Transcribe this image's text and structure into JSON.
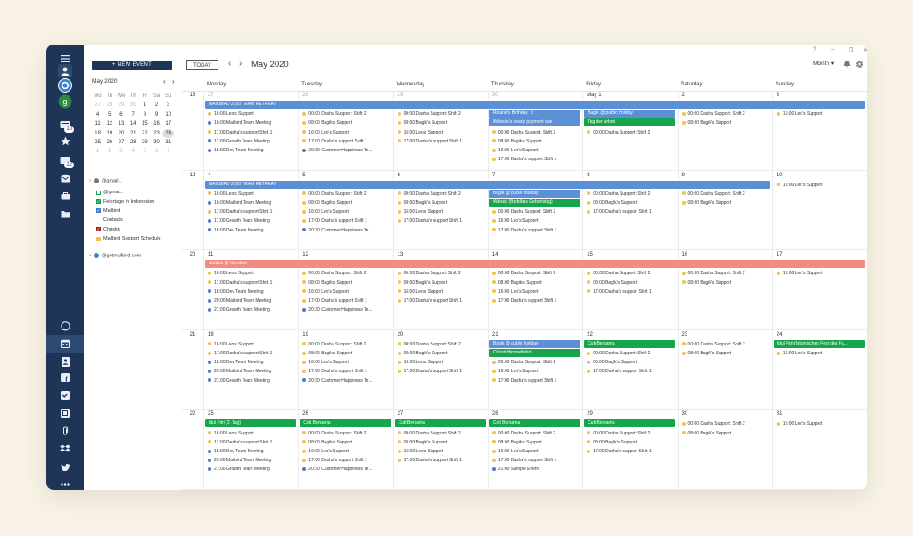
{
  "window": {
    "controls": [
      "?",
      "–",
      "❐",
      "✕"
    ]
  },
  "colors": {
    "blue": "#5b8fd6",
    "green": "#16a54a",
    "salmon": "#f08d82",
    "rail": "#1e3557",
    "dot_yellow": "#f3c14c",
    "dot_blue": "#4a7cc8"
  },
  "sidebar": {
    "new_event": "+ NEW EVENT",
    "mini_title": "May 2020",
    "weekday_heads": [
      "Mo",
      "Tu",
      "We",
      "Th",
      "Fr",
      "Sa",
      "Su"
    ],
    "mini_weeks": [
      [
        "27",
        "28",
        "29",
        "30",
        "1",
        "2",
        "3"
      ],
      [
        "4",
        "5",
        "6",
        "7",
        "8",
        "9",
        "10"
      ],
      [
        "11",
        "12",
        "13",
        "14",
        "15",
        "16",
        "17"
      ],
      [
        "18",
        "19",
        "20",
        "21",
        "22",
        "23",
        "24"
      ],
      [
        "25",
        "26",
        "27",
        "28",
        "29",
        "30",
        "31"
      ],
      [
        "1",
        "2",
        "3",
        "4",
        "5",
        "6",
        "7"
      ]
    ],
    "account1": "@gmail...",
    "calendars": [
      {
        "label": "@gmai...",
        "checked": false,
        "color": ""
      },
      {
        "label": "Feiertage in Indonesien",
        "checked": true,
        "color": "#16a54a"
      },
      {
        "label": "Mailbird",
        "checked": true,
        "color": "#4a7cc8"
      },
      {
        "label": "Contacts",
        "checked": false,
        "color": "none"
      },
      {
        "label": "Christin",
        "checked": true,
        "color": "#b01c2e"
      },
      {
        "label": "Mailbird Support Schedule",
        "checked": false,
        "color": "#f3c14c"
      }
    ],
    "account2": "@getmailbird.com"
  },
  "toolbar": {
    "today": "TODAY",
    "month_title": "May 2020",
    "view": "Month"
  },
  "day_headers": [
    "Monday",
    "Tuesday",
    "Wednesday",
    "Thursday",
    "Friday",
    "Saturday",
    "Sunday"
  ],
  "weeks": [
    {
      "num": "18",
      "days": [
        {
          "n": "27",
          "dim": true,
          "events": [
            [
              "y",
              "16:00 Leo's Support"
            ],
            [
              "b",
              "16:00 Mailbird Team Meeting"
            ],
            [
              "y",
              "17:00 Dasha's support Shift 1"
            ],
            [
              "b",
              "17:00 Growth Team Meeting"
            ],
            [
              "b",
              "18:00 Dev Team Meeting"
            ]
          ]
        },
        {
          "n": "28",
          "dim": true,
          "events": [
            [
              "y",
              "00:00 Dasha Support: Shift 2"
            ],
            [
              "y",
              "08:00 Bagik's Support"
            ],
            [
              "y",
              "16:00 Leo's Support"
            ],
            [
              "y",
              "17:00 Dasha's support Shift 1"
            ],
            [
              "b",
              "20:30 Customer Happiness Te..."
            ]
          ]
        },
        {
          "n": "29",
          "dim": true,
          "events": [
            [
              "y",
              "00:00 Dasha Support: Shift 2"
            ],
            [
              "y",
              "08:00 Bagik's Support"
            ],
            [
              "y",
              "16:00 Leo's Support"
            ],
            [
              "y",
              "17:00 Dasha's support Shift 1"
            ]
          ]
        },
        {
          "n": "30",
          "dim": true,
          "events": [
            [
              "y",
              "00:00 Dasha Support: Shift 2"
            ],
            [
              "y",
              "08:00 Bagik's Support"
            ],
            [
              "y",
              "16:00 Leo's Support"
            ],
            [
              "y",
              "17:00 Dasha's support Shift 1"
            ]
          ]
        },
        {
          "n": "May 1",
          "dim": false,
          "events": [
            [
              "y",
              "00:00 Dasha Support: Shift 2"
            ]
          ]
        },
        {
          "n": "2",
          "dim": false,
          "events": [
            [
              "y",
              "00:00 Dasha Support: Shift 2"
            ],
            [
              "y",
              "08:00 Bagik's Support"
            ]
          ]
        },
        {
          "n": "3",
          "dim": false,
          "events": [
            [
              "y",
              "16:00 Leo's Support"
            ]
          ]
        }
      ],
      "bars": [
        {
          "label": "MAILBIRD 2020 TEAM RETREAT",
          "start": 0,
          "end": 7,
          "row": 0,
          "color": "blue"
        },
        {
          "label": "Roland's Birthday :D",
          "start": 3,
          "end": 4,
          "row": 1,
          "color": "blue"
        },
        {
          "label": "Website's yearly payment due",
          "start": 3,
          "end": 4,
          "row": 2,
          "color": "blue"
        },
        {
          "label": "Bagik @ public holiday",
          "start": 4,
          "end": 5,
          "row": 1,
          "color": "blue"
        },
        {
          "label": "Tag der Arbeit",
          "start": 4,
          "end": 5,
          "row": 2,
          "color": "green"
        }
      ]
    },
    {
      "num": "19",
      "days": [
        {
          "n": "4",
          "events": [
            [
              "y",
              "16:00 Leo's Support"
            ],
            [
              "b",
              "16:00 Mailbird Team Meeting"
            ],
            [
              "y",
              "17:00 Dasha's support Shift 1"
            ],
            [
              "b",
              "17:00 Growth Team Meeting"
            ],
            [
              "b",
              "18:00 Dev Team Meeting"
            ]
          ]
        },
        {
          "n": "5",
          "events": [
            [
              "y",
              "00:00 Dasha Support: Shift 2"
            ],
            [
              "y",
              "08:00 Bagik's Support"
            ],
            [
              "y",
              "16:00 Leo's Support"
            ],
            [
              "y",
              "17:00 Dasha's support Shift 1"
            ],
            [
              "b",
              "20:30 Customer Happiness Te..."
            ]
          ]
        },
        {
          "n": "6",
          "events": [
            [
              "y",
              "00:00 Dasha Support: Shift 2"
            ],
            [
              "y",
              "08:00 Bagik's Support"
            ],
            [
              "y",
              "16:00 Leo's Support"
            ],
            [
              "y",
              "17:00 Dasha's support Shift 1"
            ]
          ]
        },
        {
          "n": "7",
          "events": [
            [
              "y",
              "00:00 Dasha Support: Shift 2"
            ],
            [
              "y",
              "16:00 Leo's Support"
            ],
            [
              "y",
              "17:00 Dasha's support Shift 1"
            ]
          ]
        },
        {
          "n": "8",
          "events": [
            [
              "y",
              "00:00 Dasha Support: Shift 2"
            ],
            [
              "y",
              "08:00 Bagik's Support"
            ],
            [
              "y",
              "17:00 Dasha's support Shift 1"
            ]
          ]
        },
        {
          "n": "9",
          "events": [
            [
              "y",
              "00:00 Dasha Support: Shift 2"
            ],
            [
              "y",
              "08:00 Bagik's Support"
            ]
          ]
        },
        {
          "n": "10",
          "events": [
            [
              "y",
              "16:00 Leo's Support"
            ]
          ]
        }
      ],
      "bars": [
        {
          "label": "MAILBIRD 2020 TEAM RETREAT",
          "start": 0,
          "end": 6,
          "row": 0,
          "color": "blue"
        },
        {
          "label": "Bagik @ public holiday",
          "start": 3,
          "end": 4,
          "row": 1,
          "color": "blue"
        },
        {
          "label": "Waisak (Buddhas Geburtstag)",
          "start": 3,
          "end": 4,
          "row": 2,
          "color": "green"
        }
      ]
    },
    {
      "num": "20",
      "days": [
        {
          "n": "11",
          "events": [
            [
              "y",
              "16:00 Leo's Support"
            ],
            [
              "y",
              "17:00 Dasha's support Shift 1"
            ],
            [
              "b",
              "18:00 Dev Team Meeting"
            ],
            [
              "b",
              "20:00 Mailbird Team Meeting"
            ],
            [
              "b",
              "21:00 Growth Team Meeting"
            ]
          ]
        },
        {
          "n": "12",
          "events": [
            [
              "y",
              "00:00 Dasha Support: Shift 2"
            ],
            [
              "y",
              "08:00 Bagik's Support"
            ],
            [
              "y",
              "16:00 Leo's Support"
            ],
            [
              "y",
              "17:00 Dasha's support Shift 1"
            ],
            [
              "b",
              "20:30 Customer Happiness Te..."
            ]
          ]
        },
        {
          "n": "13",
          "events": [
            [
              "y",
              "00:00 Dasha Support: Shift 2"
            ],
            [
              "y",
              "08:00 Bagik's Support"
            ],
            [
              "y",
              "16:00 Leo's Support"
            ],
            [
              "y",
              "17:00 Dasha's support Shift 1"
            ]
          ]
        },
        {
          "n": "14",
          "events": [
            [
              "y",
              "00:00 Dasha Support: Shift 2"
            ],
            [
              "y",
              "08:00 Bagik's Support"
            ],
            [
              "y",
              "16:00 Leo's Support"
            ],
            [
              "y",
              "17:00 Dasha's support Shift 1"
            ]
          ]
        },
        {
          "n": "15",
          "events": [
            [
              "y",
              "00:00 Dasha Support: Shift 2"
            ],
            [
              "y",
              "08:00 Bagik's Support"
            ],
            [
              "y",
              "17:00 Dasha's support Shift 1"
            ]
          ]
        },
        {
          "n": "16",
          "events": [
            [
              "y",
              "00:00 Dasha Support: Shift 2"
            ],
            [
              "y",
              "08:00 Bagik's Support"
            ]
          ]
        },
        {
          "n": "17",
          "events": [
            [
              "y",
              "16:00 Leo's Support"
            ]
          ]
        }
      ],
      "bars": [
        {
          "label": "Andrea @ Vacation",
          "start": 0,
          "end": 7,
          "row": 0,
          "color": "salmon"
        }
      ]
    },
    {
      "num": "21",
      "days": [
        {
          "n": "18",
          "events": [
            [
              "y",
              "16:00 Leo's Support"
            ],
            [
              "y",
              "17:00 Dasha's support Shift 1"
            ],
            [
              "b",
              "18:00 Dev Team Meeting"
            ],
            [
              "b",
              "20:00 Mailbird Team Meeting"
            ],
            [
              "b",
              "21:00 Growth Team Meeting"
            ]
          ]
        },
        {
          "n": "19",
          "events": [
            [
              "y",
              "00:00 Dasha Support: Shift 2"
            ],
            [
              "y",
              "08:00 Bagik's Support"
            ],
            [
              "y",
              "16:00 Leo's Support"
            ],
            [
              "y",
              "17:00 Dasha's support Shift 1"
            ],
            [
              "b",
              "20:30 Customer Happiness Te..."
            ]
          ]
        },
        {
          "n": "20",
          "events": [
            [
              "y",
              "00:00 Dasha Support: Shift 2"
            ],
            [
              "y",
              "08:00 Bagik's Support"
            ],
            [
              "y",
              "16:00 Leo's Support"
            ],
            [
              "y",
              "17:00 Dasha's support Shift 1"
            ]
          ]
        },
        {
          "n": "21",
          "events": [
            [
              "y",
              "00:00 Dasha Support: Shift 2"
            ],
            [
              "y",
              "16:00 Leo's Support"
            ],
            [
              "y",
              "17:00 Dasha's support Shift 1"
            ]
          ]
        },
        {
          "n": "22",
          "events": [
            [
              "y",
              "00:00 Dasha Support: Shift 2"
            ],
            [
              "y",
              "08:00 Bagik's Support"
            ],
            [
              "y",
              "17:00 Dasha's support Shift 1"
            ]
          ]
        },
        {
          "n": "23",
          "events": [
            [
              "y",
              "00:00 Dasha Support: Shift 2"
            ],
            [
              "y",
              "08:00 Bagik's Support"
            ]
          ]
        },
        {
          "n": "24",
          "events": [
            [
              "y",
              "16:00 Leo's Support"
            ]
          ]
        }
      ],
      "bars": [
        {
          "label": "Bagik @ public holiday",
          "start": 3,
          "end": 4,
          "row": 0,
          "color": "blue"
        },
        {
          "label": "Christi Himmelfahrt",
          "start": 3,
          "end": 4,
          "row": 1,
          "color": "green"
        },
        {
          "label": "Cuti Bersama",
          "start": 4,
          "end": 5,
          "row": 0,
          "color": "green"
        },
        {
          "label": "Idul Fitri (Islamisches Fest des Fa...",
          "start": 6,
          "end": 7,
          "row": 0,
          "color": "green"
        }
      ]
    },
    {
      "num": "22",
      "days": [
        {
          "n": "25",
          "events": [
            [
              "y",
              "16:00 Leo's Support"
            ],
            [
              "y",
              "17:00 Dasha's support Shift 1"
            ],
            [
              "b",
              "18:00 Dev Team Meeting"
            ],
            [
              "b",
              "20:00 Mailbird Team Meeting"
            ],
            [
              "b",
              "21:00 Growth Team Meeting"
            ]
          ]
        },
        {
          "n": "26",
          "events": [
            [
              "y",
              "00:00 Dasha Support: Shift 2"
            ],
            [
              "y",
              "08:00 Bagik's Support"
            ],
            [
              "y",
              "16:00 Leo's Support"
            ],
            [
              "y",
              "17:00 Dasha's support Shift 1"
            ],
            [
              "b",
              "20:30 Customer Happiness Te..."
            ]
          ]
        },
        {
          "n": "27",
          "events": [
            [
              "y",
              "00:00 Dasha Support: Shift 2"
            ],
            [
              "y",
              "08:00 Bagik's Support"
            ],
            [
              "y",
              "16:00 Leo's Support"
            ],
            [
              "y",
              "17:00 Dasha's support Shift 1"
            ]
          ]
        },
        {
          "n": "28",
          "events": [
            [
              "y",
              "00:00 Dasha Support: Shift 2"
            ],
            [
              "y",
              "08:00 Bagik's Support"
            ],
            [
              "y",
              "16:00 Leo's Support"
            ],
            [
              "y",
              "17:00 Dasha's support Shift 1"
            ],
            [
              "b",
              "21:00 Sample Event"
            ]
          ]
        },
        {
          "n": "29",
          "events": [
            [
              "y",
              "00:00 Dasha Support: Shift 2"
            ],
            [
              "y",
              "08:00 Bagik's Support"
            ],
            [
              "y",
              "17:00 Dasha's support Shift 1"
            ]
          ]
        },
        {
          "n": "30",
          "events": [
            [
              "y",
              "00:00 Dasha Support: Shift 2"
            ],
            [
              "y",
              "08:00 Bagik's Support"
            ]
          ]
        },
        {
          "n": "31",
          "events": [
            [
              "y",
              "16:00 Leo's Support"
            ]
          ]
        }
      ],
      "bars": [
        {
          "label": "Idul Fitri (2. Tag)",
          "start": 0,
          "end": 1,
          "row": 0,
          "color": "green"
        },
        {
          "label": "Cuti Bersama",
          "start": 1,
          "end": 2,
          "row": 0,
          "color": "green"
        },
        {
          "label": "Cuti Bersama",
          "start": 2,
          "end": 3,
          "row": 0,
          "color": "green"
        },
        {
          "label": "Cuti Bersama",
          "start": 3,
          "end": 4,
          "row": 0,
          "color": "green"
        },
        {
          "label": "Cuti Bersama",
          "start": 4,
          "end": 5,
          "row": 0,
          "color": "green"
        }
      ]
    }
  ],
  "rail_icons": [
    "menu-icon",
    "contacts-icon",
    "account-edge-icon",
    "account-google-icon",
    "inbox-icon",
    "star-icon",
    "drafts-icon",
    "archive-icon",
    "briefcase-icon",
    "folder-icon",
    "whatsapp-icon",
    "calendar-icon",
    "contacts-app-icon",
    "facebook-icon",
    "todo-icon",
    "docs-icon",
    "attachment-icon",
    "dropbox-icon",
    "twitter-icon",
    "more-icon"
  ],
  "rail_badges": {
    "inbox": "10",
    "drafts": "12"
  }
}
